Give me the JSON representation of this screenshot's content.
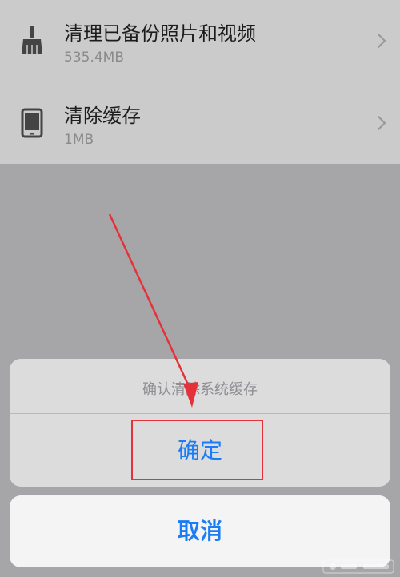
{
  "settings_list": {
    "items": [
      {
        "icon": "broom-icon",
        "title": "清理已备份照片和视频",
        "subtitle": "535.4MB"
      },
      {
        "icon": "phone-icon",
        "title": "清除缓存",
        "subtitle": "1MB"
      }
    ]
  },
  "action_sheet": {
    "message": "确认清除系统缓存",
    "confirm_label": "确定",
    "cancel_label": "取消"
  },
  "colors": {
    "accent": "#1a7df5",
    "annotation": "#e5323a"
  },
  "annotation": {
    "arrow_icon": "red-arrow-icon",
    "box": "red-highlight-box"
  },
  "watermark": {
    "icon": "baidu-watermark-icon"
  }
}
